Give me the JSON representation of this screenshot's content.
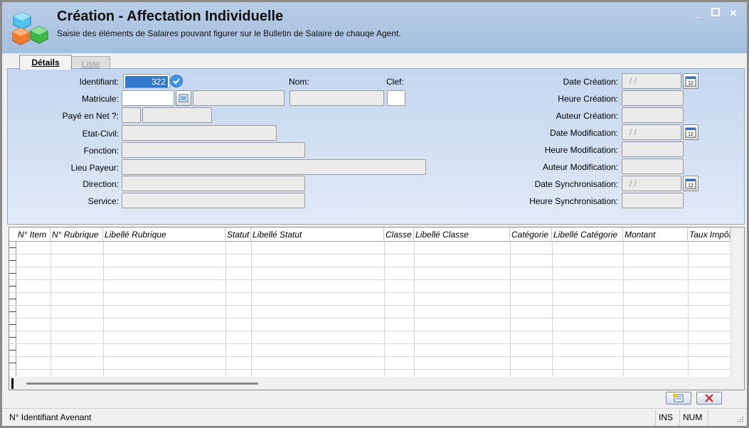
{
  "header": {
    "title": "Création - Affectation Individuelle",
    "subtitle": "Saisie des éléments de Salaires pouvant figurer sur le Bulletin de Salaire de chauqe Agent.",
    "controls": {
      "minimize": "_",
      "maximize": "□",
      "close": "✕"
    },
    "icon": "colored-cubes-icon"
  },
  "tabs": [
    {
      "label": "Détails",
      "active": true
    },
    {
      "label": "Liste",
      "active": false
    }
  ],
  "form": {
    "identifiant_label": "Identifiant:",
    "identifiant_value": "322",
    "nom_label": "Nom:",
    "clef_label": "Clef:",
    "matricule_label": "Matricule:",
    "paye_net_label": "Payé en Net ?:",
    "etat_civil_label": "Etat-Civil:",
    "fonction_label": "Fonction:",
    "lieu_payeur_label": "Lieu Payeur:",
    "direction_label": "Direction:",
    "service_label": "Service:",
    "date_creation_label": "Date Création:",
    "date_creation_value": "/ /",
    "heure_creation_label": "Heure Création:",
    "auteur_creation_label": "Auteur Création:",
    "date_modification_label": "Date Modification:",
    "date_modification_value": "/ /",
    "heure_modification_label": "Heure Modification:",
    "auteur_modification_label": "Auteur Modification:",
    "date_synchronisation_label": "Date Synchronisation:",
    "date_synchronisation_value": "/ /",
    "heure_synchronisation_label": "Heure Synchronisation:",
    "calendar_day": "12"
  },
  "grid": {
    "columns": [
      "N° Item",
      "N° Rubrique",
      "Libellé Rubrique",
      "Statut",
      "Libellé Statut",
      "Classe",
      "Libellé Classe",
      "Catégorie",
      "Libellé Catégorie",
      "Montant",
      "Taux Impôt"
    ],
    "rows": []
  },
  "status_bar": {
    "message": "N° Identifiant Avenant",
    "ins": "INS",
    "num": "NUM"
  },
  "colors": {
    "header_bg": "#b8cde6",
    "panel_bg": "#c4d6ef",
    "selection": "#3078d0",
    "check": "#3c95e6"
  }
}
